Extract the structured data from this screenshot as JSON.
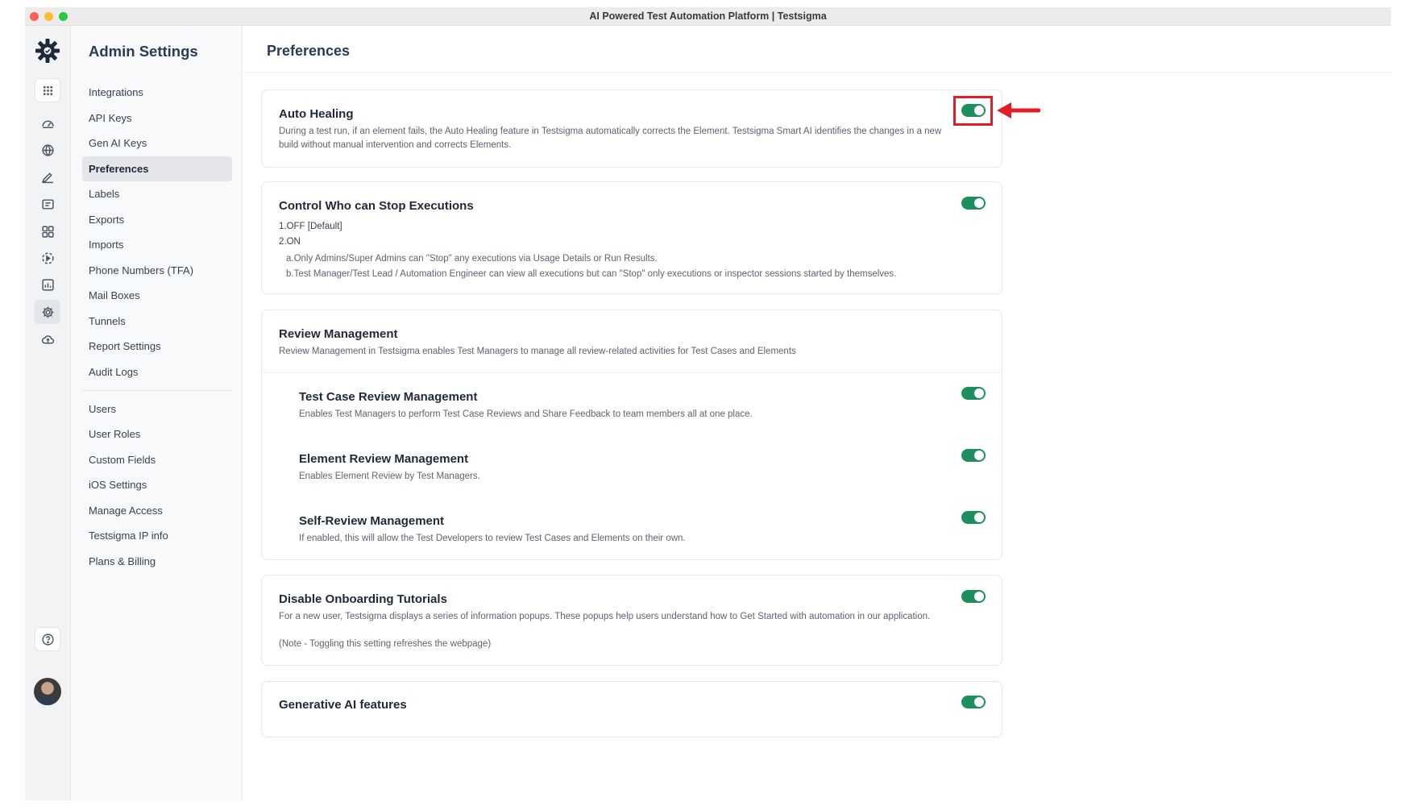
{
  "window": {
    "title": "AI Powered Test Automation Platform | Testsigma"
  },
  "rail": {
    "icons": [
      "grid-icon",
      "dashboard-icon",
      "web-icon",
      "edit-icon",
      "list-icon",
      "apps-icon",
      "run-icon",
      "reports-icon",
      "settings-icon",
      "cloud-upload-icon"
    ],
    "bottom": [
      "help-icon",
      "avatar"
    ]
  },
  "sidebar": {
    "heading": "Admin Settings",
    "group1": [
      {
        "label": "Integrations"
      },
      {
        "label": "API Keys"
      },
      {
        "label": "Gen AI Keys"
      },
      {
        "label": "Preferences",
        "active": true
      },
      {
        "label": "Labels"
      },
      {
        "label": "Exports"
      },
      {
        "label": "Imports"
      },
      {
        "label": "Phone Numbers (TFA)"
      },
      {
        "label": "Mail Boxes"
      },
      {
        "label": "Tunnels"
      },
      {
        "label": "Report Settings"
      },
      {
        "label": "Audit Logs"
      }
    ],
    "group2": [
      {
        "label": "Users"
      },
      {
        "label": "User Roles"
      },
      {
        "label": "Custom Fields"
      },
      {
        "label": "iOS Settings"
      },
      {
        "label": "Manage Access"
      },
      {
        "label": "Testsigma IP info"
      },
      {
        "label": "Plans & Billing"
      }
    ]
  },
  "main": {
    "title": "Preferences",
    "auto_healing": {
      "title": "Auto Healing",
      "desc1": "During a test run, if an element fails, the Auto Healing feature in Testsigma automatically corrects the Element. Testsigma Smart AI identifies the changes in a new",
      "desc2": "build without manual intervention and corrects Elements.",
      "enabled": true
    },
    "stop_exec": {
      "title": "Control Who can Stop Executions",
      "line1": "1.OFF [Default]",
      "line2": "2.ON",
      "line3": "a.Only Admins/Super Admins can \"Stop\" any executions via Usage Details or Run Results.",
      "line4": "b.Test Manager/Test Lead / Automation Engineer can view all executions but can \"Stop\" only executions or inspector sessions started by themselves.",
      "enabled": true
    },
    "review": {
      "title": "Review Management",
      "desc": "Review Management in Testsigma enables Test Managers to manage all review-related activities for Test Cases and Elements",
      "test_case": {
        "title": "Test Case Review Management",
        "desc": "Enables Test Managers to perform Test Case Reviews and Share Feedback to team members all at one place.",
        "enabled": true
      },
      "element": {
        "title": "Element Review Management",
        "desc": "Enables Element Review by Test Managers.",
        "enabled": true
      },
      "self": {
        "title": "Self-Review Management",
        "desc": "If enabled, this will allow the Test Developers to review Test Cases and Elements on their own.",
        "enabled": true
      }
    },
    "onboarding": {
      "title": "Disable Onboarding Tutorials",
      "desc": "For a new user, Testsigma displays a series of information popups. These popups help users understand how to Get Started with automation in our application.",
      "note": "(Note - Toggling this setting refreshes the webpage)",
      "enabled": true
    },
    "genai": {
      "title": "Generative AI features",
      "enabled": true
    }
  },
  "colors": {
    "toggle_on": "#1f8e5e",
    "highlight": "#e11d2a",
    "brand": "#1e293b"
  }
}
